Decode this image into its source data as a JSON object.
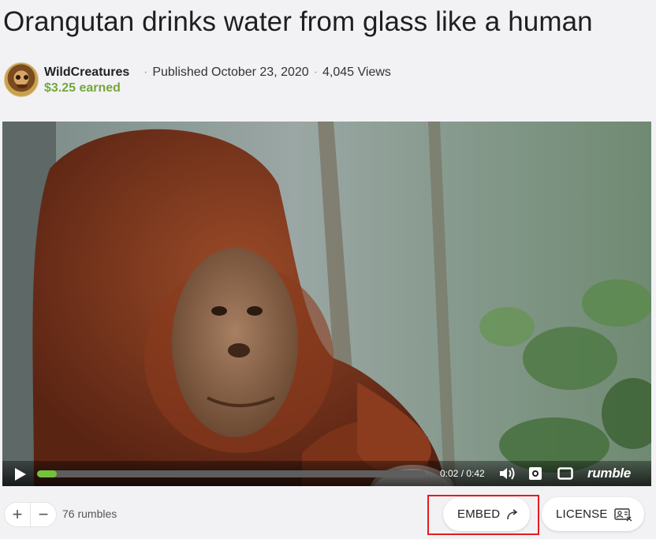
{
  "video": {
    "title": "Orangutan drinks water from glass like a human",
    "channel": "WildCreatures",
    "published": "Published October 23, 2020",
    "views": "4,045 Views",
    "earned": "$3.25 earned"
  },
  "player": {
    "current_time": "0:02",
    "duration": "0:42",
    "time_display": "0:02 / 0:42",
    "progress_fraction": 0.05,
    "brand": "rumble"
  },
  "actions": {
    "rumbles": "76 rumbles",
    "embed_label": "EMBED",
    "license_label": "LICENSE"
  },
  "colors": {
    "accent": "#74c23b",
    "earned": "#74a83b",
    "highlight": "#e41d1d"
  },
  "icons": [
    "avatar",
    "play-icon",
    "volume-icon",
    "settings-gear-icon",
    "fullscreen-icon",
    "plus-icon",
    "minus-icon",
    "share-arrow-icon",
    "license-icon"
  ]
}
